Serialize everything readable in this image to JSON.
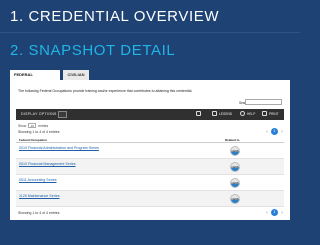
{
  "header1": {
    "title": "1. CREDENTIAL OVERVIEW"
  },
  "header2": {
    "title": "2. SNAPSHOT DETAIL"
  },
  "tabs": [
    {
      "label": "FEDERAL OCCUPATIONS"
    },
    {
      "label": "CIVILIAN"
    }
  ],
  "description": "The following Federal Occupations provide training and/or experience that contributes to attaining this credential.",
  "search": {
    "label": "Search:",
    "value": ""
  },
  "toolbar": {
    "display_options": "DISPLAY OPTIONS",
    "legend": "LEGEND",
    "help": "HELP",
    "print": "PRINT"
  },
  "show_entries": {
    "prefix": "Show",
    "value": "10",
    "suffix": "entries"
  },
  "info_top": "Showing 1 to 4 of 4 entries",
  "info_bottom": "Showing 1 to 4 of 4 entries",
  "pager": {
    "page": "1"
  },
  "table": {
    "columns": [
      "Federal Occupation",
      "Related to"
    ],
    "rows": [
      {
        "occupation": "0019 Financial Administration and Program Series",
        "badge": "CRDB"
      },
      {
        "occupation": "0510 Financial Management Series",
        "badge": "CRDB"
      },
      {
        "occupation": "0511 Accounting Series",
        "badge": "CRDB"
      },
      {
        "occupation": "1125 Maintenance Series",
        "badge": "CRDB"
      }
    ]
  }
}
